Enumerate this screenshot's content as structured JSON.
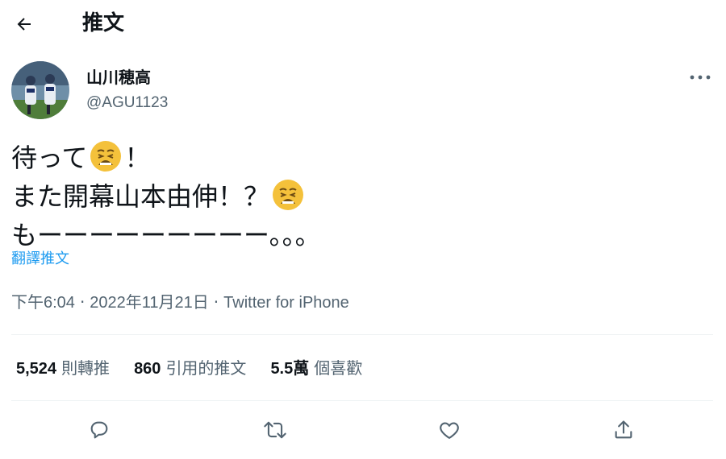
{
  "header": {
    "title": "推文"
  },
  "author": {
    "display_name": "山川穂高",
    "handle": "@AGU1123"
  },
  "tweet": {
    "lines": [
      {
        "text": "待って",
        "emoji": "weary-face",
        "after": "！"
      },
      {
        "text": "また開幕山本由伸！？",
        "emoji": "weary-face",
        "after": ""
      },
      {
        "text": "もーーーーーーーーー。。。",
        "emoji": "",
        "after": ""
      }
    ],
    "translate_label": "翻譯推文"
  },
  "meta": {
    "time": "下午6:04",
    "separator": "·",
    "date": "2022年11月21日",
    "source": "Twitter for iPhone"
  },
  "stats": {
    "retweets": {
      "count": "5,524",
      "label": "則轉推"
    },
    "quotes": {
      "count": "860",
      "label": "引用的推文"
    },
    "likes": {
      "count": "5.5萬",
      "label": "個喜歡"
    }
  },
  "icons": {
    "back": "arrow-left-icon",
    "more": "more-horizontal-icon",
    "reply": "reply-icon",
    "retweet": "retweet-icon",
    "like": "heart-icon",
    "share": "share-icon"
  },
  "colors": {
    "link": "#1d9bf0",
    "secondary_text": "#536471",
    "primary_text": "#0f1419"
  }
}
